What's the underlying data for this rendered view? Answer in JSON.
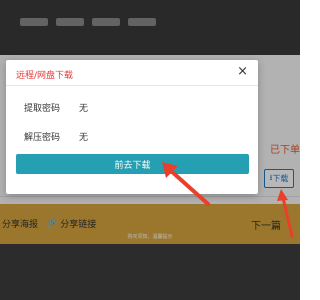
{
  "background": {
    "right_link": "已下单",
    "download_btn_label": "下载",
    "share_poster": "分享海报",
    "share_link": "分享链接",
    "next": "下一篇",
    "tip": "购买须知，温馨提示"
  },
  "modal": {
    "title": "远程/网盘下载",
    "close_label": "×",
    "rows": [
      {
        "label": "提取密码",
        "value": "无"
      },
      {
        "label": "解压密码",
        "value": "无"
      }
    ],
    "go_button": "前去下载"
  },
  "colors": {
    "title_red": "#e53935",
    "button_teal": "#259fb2",
    "arrow_red": "#e8402a",
    "share_bar": "#d6a63d"
  }
}
